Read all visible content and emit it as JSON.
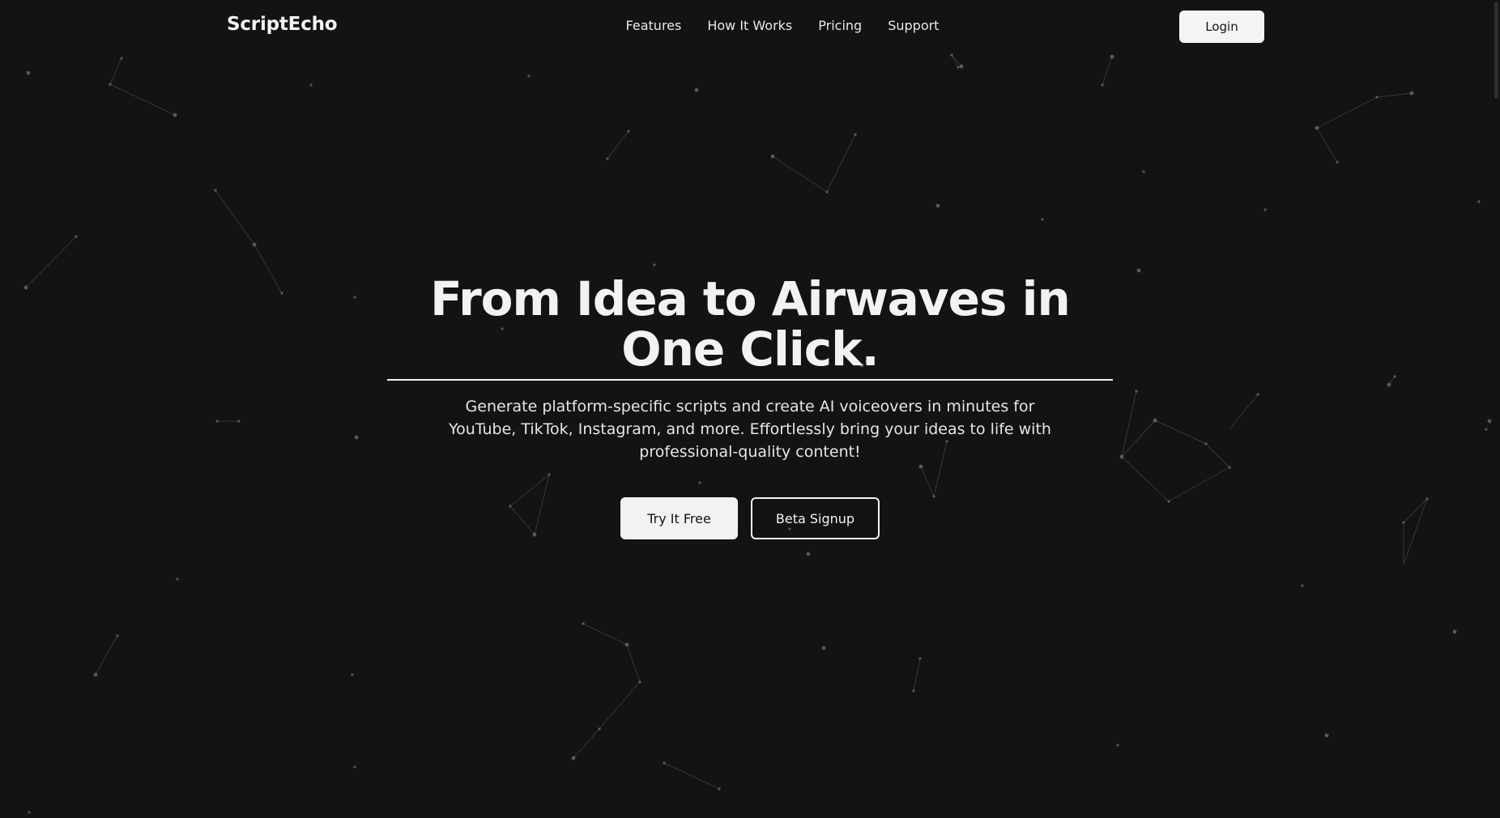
{
  "colors": {
    "background": "#131313",
    "text": "#f2f2f2",
    "button_light": "#f4f4f4",
    "particle": "#6a6a6a"
  },
  "header": {
    "brand": "ScriptEcho",
    "nav": [
      "Features",
      "How It Works",
      "Pricing",
      "Support"
    ],
    "login_label": "Login"
  },
  "hero": {
    "title": "From Idea to Airwaves in One Click.",
    "subtitle": "Generate platform-specific scripts and create AI voiceovers in minutes for YouTube, TikTok, Instagram, and more. Effortlessly bring your ideas to life with professional-quality content!",
    "primary_cta": "Try It Free",
    "secondary_cta": "Beta Signup"
  }
}
